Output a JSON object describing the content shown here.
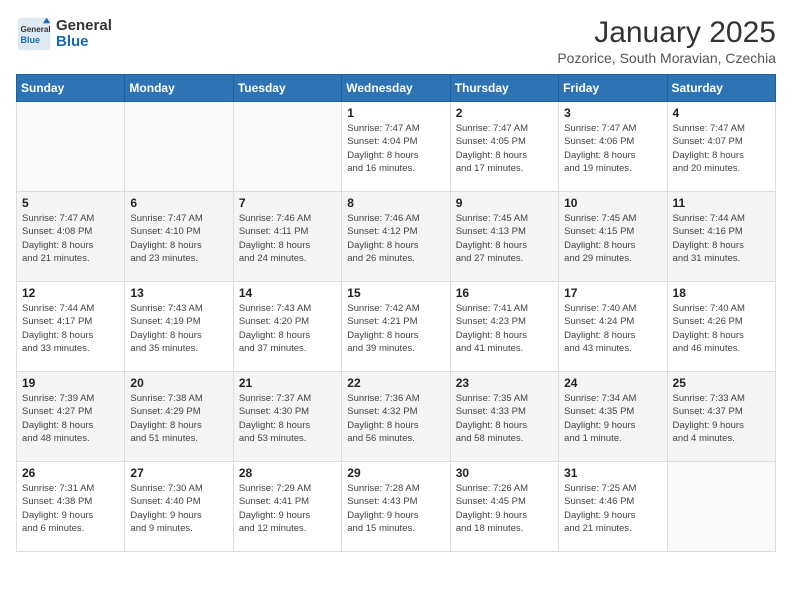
{
  "header": {
    "logo_general": "General",
    "logo_blue": "Blue",
    "month_title": "January 2025",
    "location": "Pozorice, South Moravian, Czechia"
  },
  "weekdays": [
    "Sunday",
    "Monday",
    "Tuesday",
    "Wednesday",
    "Thursday",
    "Friday",
    "Saturday"
  ],
  "weeks": [
    [
      {
        "day": "",
        "info": ""
      },
      {
        "day": "",
        "info": ""
      },
      {
        "day": "",
        "info": ""
      },
      {
        "day": "1",
        "info": "Sunrise: 7:47 AM\nSunset: 4:04 PM\nDaylight: 8 hours\nand 16 minutes."
      },
      {
        "day": "2",
        "info": "Sunrise: 7:47 AM\nSunset: 4:05 PM\nDaylight: 8 hours\nand 17 minutes."
      },
      {
        "day": "3",
        "info": "Sunrise: 7:47 AM\nSunset: 4:06 PM\nDaylight: 8 hours\nand 19 minutes."
      },
      {
        "day": "4",
        "info": "Sunrise: 7:47 AM\nSunset: 4:07 PM\nDaylight: 8 hours\nand 20 minutes."
      }
    ],
    [
      {
        "day": "5",
        "info": "Sunrise: 7:47 AM\nSunset: 4:08 PM\nDaylight: 8 hours\nand 21 minutes."
      },
      {
        "day": "6",
        "info": "Sunrise: 7:47 AM\nSunset: 4:10 PM\nDaylight: 8 hours\nand 23 minutes."
      },
      {
        "day": "7",
        "info": "Sunrise: 7:46 AM\nSunset: 4:11 PM\nDaylight: 8 hours\nand 24 minutes."
      },
      {
        "day": "8",
        "info": "Sunrise: 7:46 AM\nSunset: 4:12 PM\nDaylight: 8 hours\nand 26 minutes."
      },
      {
        "day": "9",
        "info": "Sunrise: 7:45 AM\nSunset: 4:13 PM\nDaylight: 8 hours\nand 27 minutes."
      },
      {
        "day": "10",
        "info": "Sunrise: 7:45 AM\nSunset: 4:15 PM\nDaylight: 8 hours\nand 29 minutes."
      },
      {
        "day": "11",
        "info": "Sunrise: 7:44 AM\nSunset: 4:16 PM\nDaylight: 8 hours\nand 31 minutes."
      }
    ],
    [
      {
        "day": "12",
        "info": "Sunrise: 7:44 AM\nSunset: 4:17 PM\nDaylight: 8 hours\nand 33 minutes."
      },
      {
        "day": "13",
        "info": "Sunrise: 7:43 AM\nSunset: 4:19 PM\nDaylight: 8 hours\nand 35 minutes."
      },
      {
        "day": "14",
        "info": "Sunrise: 7:43 AM\nSunset: 4:20 PM\nDaylight: 8 hours\nand 37 minutes."
      },
      {
        "day": "15",
        "info": "Sunrise: 7:42 AM\nSunset: 4:21 PM\nDaylight: 8 hours\nand 39 minutes."
      },
      {
        "day": "16",
        "info": "Sunrise: 7:41 AM\nSunset: 4:23 PM\nDaylight: 8 hours\nand 41 minutes."
      },
      {
        "day": "17",
        "info": "Sunrise: 7:40 AM\nSunset: 4:24 PM\nDaylight: 8 hours\nand 43 minutes."
      },
      {
        "day": "18",
        "info": "Sunrise: 7:40 AM\nSunset: 4:26 PM\nDaylight: 8 hours\nand 46 minutes."
      }
    ],
    [
      {
        "day": "19",
        "info": "Sunrise: 7:39 AM\nSunset: 4:27 PM\nDaylight: 8 hours\nand 48 minutes."
      },
      {
        "day": "20",
        "info": "Sunrise: 7:38 AM\nSunset: 4:29 PM\nDaylight: 8 hours\nand 51 minutes."
      },
      {
        "day": "21",
        "info": "Sunrise: 7:37 AM\nSunset: 4:30 PM\nDaylight: 8 hours\nand 53 minutes."
      },
      {
        "day": "22",
        "info": "Sunrise: 7:36 AM\nSunset: 4:32 PM\nDaylight: 8 hours\nand 56 minutes."
      },
      {
        "day": "23",
        "info": "Sunrise: 7:35 AM\nSunset: 4:33 PM\nDaylight: 8 hours\nand 58 minutes."
      },
      {
        "day": "24",
        "info": "Sunrise: 7:34 AM\nSunset: 4:35 PM\nDaylight: 9 hours\nand 1 minute."
      },
      {
        "day": "25",
        "info": "Sunrise: 7:33 AM\nSunset: 4:37 PM\nDaylight: 9 hours\nand 4 minutes."
      }
    ],
    [
      {
        "day": "26",
        "info": "Sunrise: 7:31 AM\nSunset: 4:38 PM\nDaylight: 9 hours\nand 6 minutes."
      },
      {
        "day": "27",
        "info": "Sunrise: 7:30 AM\nSunset: 4:40 PM\nDaylight: 9 hours\nand 9 minutes."
      },
      {
        "day": "28",
        "info": "Sunrise: 7:29 AM\nSunset: 4:41 PM\nDaylight: 9 hours\nand 12 minutes."
      },
      {
        "day": "29",
        "info": "Sunrise: 7:28 AM\nSunset: 4:43 PM\nDaylight: 9 hours\nand 15 minutes."
      },
      {
        "day": "30",
        "info": "Sunrise: 7:26 AM\nSunset: 4:45 PM\nDaylight: 9 hours\nand 18 minutes."
      },
      {
        "day": "31",
        "info": "Sunrise: 7:25 AM\nSunset: 4:46 PM\nDaylight: 9 hours\nand 21 minutes."
      },
      {
        "day": "",
        "info": ""
      }
    ]
  ]
}
